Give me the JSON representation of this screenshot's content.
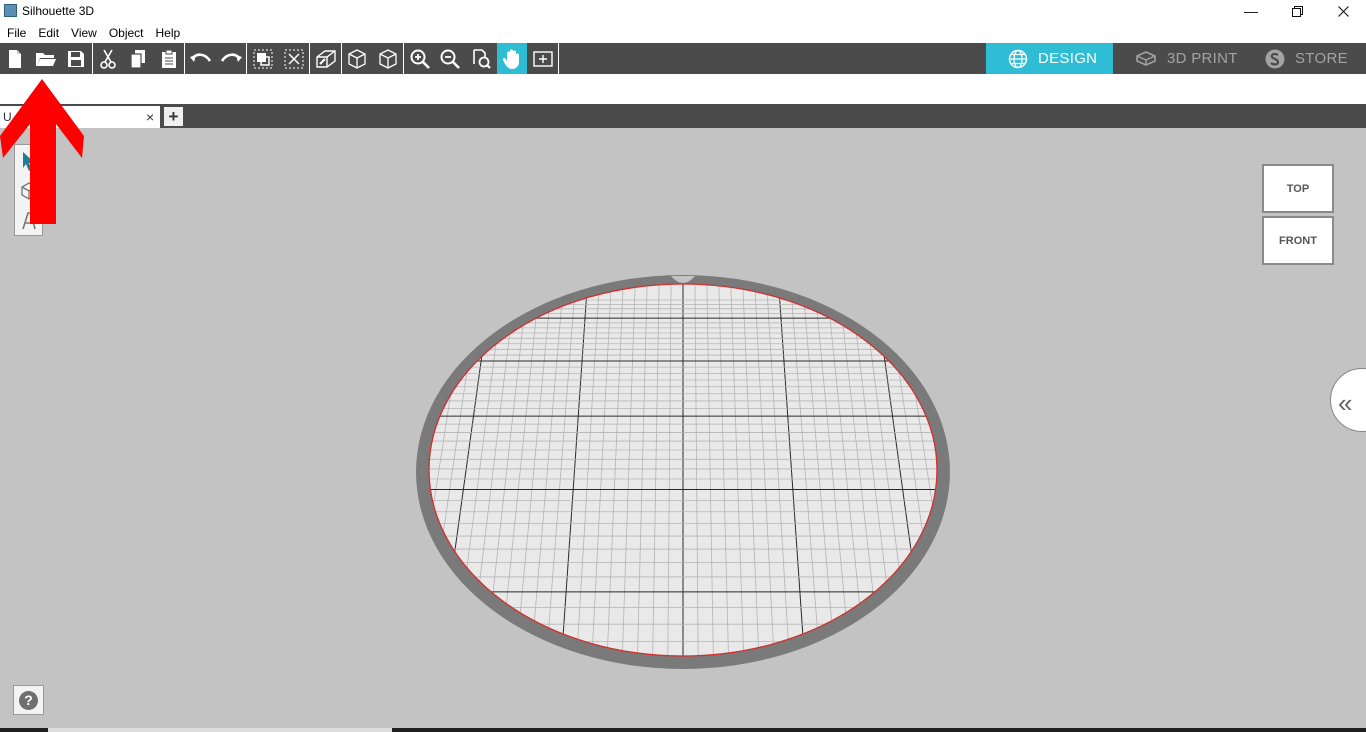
{
  "window": {
    "title": "Silhouette 3D",
    "minimize_icon": "minimize-icon",
    "restore_icon": "restore-icon",
    "close_icon": "close-icon"
  },
  "menu": [
    "File",
    "Edit",
    "View",
    "Object",
    "Help"
  ],
  "toolbar": {
    "groups": [
      [
        "new-file-icon",
        "open-folder-icon",
        "save-icon"
      ],
      [
        "cut-icon",
        "copy-icon",
        "paste-icon"
      ],
      [
        "undo-icon",
        "redo-icon"
      ],
      [
        "group-icon",
        "ungroup-icon"
      ],
      [
        "extrude-icon",
        "solid-cube-icon",
        "wireframe-cube-icon"
      ],
      [
        "zoom-in-icon",
        "zoom-out-icon",
        "zoom-fit-icon",
        "pan-hand-icon",
        "add-plane-icon"
      ]
    ],
    "active_tool": "pan-hand-icon"
  },
  "modes": {
    "design": "DESIGN",
    "print": "3D PRINT",
    "store": "STORE",
    "active": "design"
  },
  "doc_tab": {
    "label": "U",
    "close": "×",
    "add": "+"
  },
  "left_tools": [
    "select-arrow-icon",
    "cube-icon",
    "text-icon"
  ],
  "view_cube": {
    "top": "TOP",
    "front": "FRONT"
  },
  "side_panel": {
    "expand_icon": "«"
  },
  "help": {
    "icon": "?"
  },
  "colors": {
    "toolbar_bg": "#4b4b4b",
    "accent": "#2ebdd4",
    "viewport_bg": "#c3c3c3",
    "annotation": "#ff0000",
    "plate_edge": "#d32f2f"
  }
}
